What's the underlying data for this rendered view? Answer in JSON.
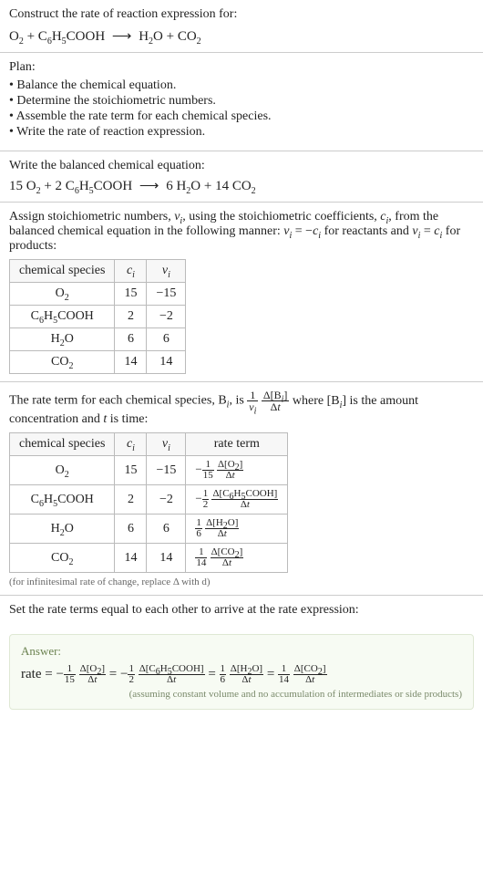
{
  "intro": {
    "prompt": "Construct the rate of reaction expression for:",
    "equation_html": "O<sub>2</sub> + C<sub>6</sub>H<sub>5</sub>COOH <span class='arrow'>⟶</span> H<sub>2</sub>O + CO<sub>2</sub>"
  },
  "plan": {
    "heading": "Plan:",
    "steps": [
      "Balance the chemical equation.",
      "Determine the stoichiometric numbers.",
      "Assemble the rate term for each chemical species.",
      "Write the rate of reaction expression."
    ]
  },
  "balance": {
    "heading": "Write the balanced chemical equation:",
    "equation_html": "15 O<sub>2</sub> + 2 C<sub>6</sub>H<sub>5</sub>COOH <span class='arrow'>⟶</span> 6 H<sub>2</sub>O + 14 CO<sub>2</sub>"
  },
  "assign": {
    "heading_html": "Assign stoichiometric numbers, <span class='ital'>ν<sub>i</sub></span>, using the stoichiometric coefficients, <span class='ital'>c<sub>i</sub></span>, from the balanced chemical equation in the following manner: <span class='ital'>ν<sub>i</sub></span> = −<span class='ital'>c<sub>i</sub></span> for reactants and <span class='ital'>ν<sub>i</sub></span> = <span class='ital'>c<sub>i</sub></span> for products:",
    "headers": [
      "chemical species",
      "c_i",
      "ν_i"
    ],
    "rows": [
      {
        "sp": "O<sub>2</sub>",
        "c": "15",
        "v": "−15"
      },
      {
        "sp": "C<sub>6</sub>H<sub>5</sub>COOH",
        "c": "2",
        "v": "−2"
      },
      {
        "sp": "H<sub>2</sub>O",
        "c": "6",
        "v": "6"
      },
      {
        "sp": "CO<sub>2</sub>",
        "c": "14",
        "v": "14"
      }
    ]
  },
  "rateterm": {
    "heading_pre": "The rate term for each chemical species, B",
    "heading_mid": ", is ",
    "heading_post_html": " where [B<sub><span class='ital'>i</span></sub>] is the amount concentration and <span class='ital'>t</span> is time:",
    "headers": [
      "chemical species",
      "c_i",
      "ν_i",
      "rate term"
    ],
    "rows": [
      {
        "sp": "O<sub>2</sub>",
        "c": "15",
        "v": "−15",
        "rt_sign": "−",
        "rt_den": "15",
        "rt_conc": "Δ[O<sub>2</sub>]"
      },
      {
        "sp": "C<sub>6</sub>H<sub>5</sub>COOH",
        "c": "2",
        "v": "−2",
        "rt_sign": "−",
        "rt_den": "2",
        "rt_conc": "Δ[C<sub>6</sub>H<sub>5</sub>COOH]"
      },
      {
        "sp": "H<sub>2</sub>O",
        "c": "6",
        "v": "6",
        "rt_sign": "",
        "rt_den": "6",
        "rt_conc": "Δ[H<sub>2</sub>O]"
      },
      {
        "sp": "CO<sub>2</sub>",
        "c": "14",
        "v": "14",
        "rt_sign": "",
        "rt_den": "14",
        "rt_conc": "Δ[CO<sub>2</sub>]"
      }
    ],
    "note": "(for infinitesimal rate of change, replace Δ with d)"
  },
  "final": {
    "heading": "Set the rate terms equal to each other to arrive at the rate expression:"
  },
  "answer": {
    "label": "Answer:",
    "prefix": "rate = ",
    "terms": [
      {
        "sign": "−",
        "den": "15",
        "conc": "Δ[O<sub>2</sub>]"
      },
      {
        "sign": "−",
        "den": "2",
        "conc": "Δ[C<sub>6</sub>H<sub>5</sub>COOH]"
      },
      {
        "sign": "",
        "den": "6",
        "conc": "Δ[H<sub>2</sub>O]"
      },
      {
        "sign": "",
        "den": "14",
        "conc": "Δ[CO<sub>2</sub>]"
      }
    ],
    "note": "(assuming constant volume and no accumulation of intermediates or side products)"
  },
  "chart_data": {
    "type": "table",
    "title": "Stoichiometric numbers and rate terms",
    "tables": [
      {
        "columns": [
          "chemical species",
          "c_i",
          "ν_i"
        ],
        "rows": [
          [
            "O2",
            15,
            -15
          ],
          [
            "C6H5COOH",
            2,
            -2
          ],
          [
            "H2O",
            6,
            6
          ],
          [
            "CO2",
            14,
            14
          ]
        ]
      },
      {
        "columns": [
          "chemical species",
          "c_i",
          "ν_i",
          "rate term"
        ],
        "rows": [
          [
            "O2",
            15,
            -15,
            "-(1/15) Δ[O2]/Δt"
          ],
          [
            "C6H5COOH",
            2,
            -2,
            "-(1/2) Δ[C6H5COOH]/Δt"
          ],
          [
            "H2O",
            6,
            6,
            "(1/6) Δ[H2O]/Δt"
          ],
          [
            "CO2",
            14,
            14,
            "(1/14) Δ[CO2]/Δt"
          ]
        ]
      }
    ],
    "balanced_equation": "15 O2 + 2 C6H5COOH → 6 H2O + 14 CO2",
    "rate_expression": "rate = -(1/15) Δ[O2]/Δt = -(1/2) Δ[C6H5COOH]/Δt = (1/6) Δ[H2O]/Δt = (1/14) Δ[CO2]/Δt"
  }
}
